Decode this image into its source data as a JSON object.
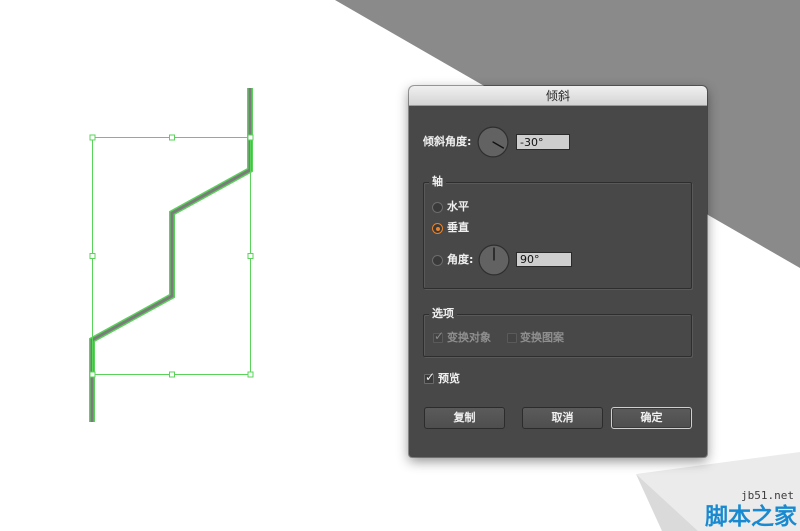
{
  "colors": {
    "accent": "#e8842e",
    "selection": "#5ad35a",
    "background_shape": "#8a8a8a",
    "watermark_brand": "#1a8ad0"
  },
  "dialog": {
    "title": "倾斜",
    "shear_angle": {
      "label": "倾斜角度:",
      "value": "-30°"
    },
    "axis": {
      "legend": "轴",
      "horizontal": {
        "label": "水平",
        "selected": false
      },
      "vertical": {
        "label": "垂直",
        "selected": true
      },
      "angle": {
        "label": "角度:",
        "selected": false,
        "value": "90°"
      }
    },
    "options": {
      "legend": "选项",
      "transform_objects": {
        "label": "变换对象",
        "checked": true,
        "enabled": false
      },
      "transform_patterns": {
        "label": "变换图案",
        "checked": false,
        "enabled": false
      }
    },
    "preview": {
      "label": "预览",
      "checked": true
    },
    "buttons": {
      "copy": "复制",
      "cancel": "取消",
      "ok": "确定"
    }
  },
  "watermark": {
    "site": "jb51.net",
    "name": "脚本之家"
  }
}
